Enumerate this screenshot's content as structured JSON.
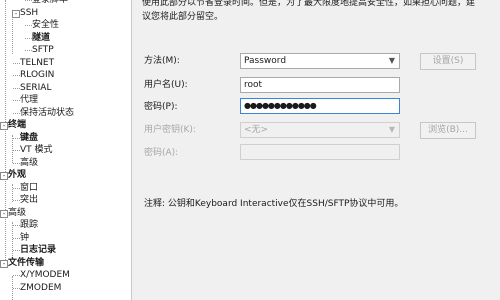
{
  "tree": {
    "items": [
      {
        "label": "登录脚本",
        "level": 2
      },
      {
        "label": "SSH",
        "level": 1,
        "toggle": "-"
      },
      {
        "label": "安全性",
        "level": 2
      },
      {
        "label": "隧道",
        "level": 2,
        "bold": true
      },
      {
        "label": "SFTP",
        "level": 2
      },
      {
        "label": "TELNET",
        "level": 1
      },
      {
        "label": "RLOGIN",
        "level": 1
      },
      {
        "label": "SERIAL",
        "level": 1
      },
      {
        "label": "代理",
        "level": 1
      },
      {
        "label": "保持活动状态",
        "level": 1
      },
      {
        "label": "终端",
        "level": 0,
        "toggle": "-",
        "bold": true
      },
      {
        "label": "键盘",
        "level": 1,
        "bold": true
      },
      {
        "label": "VT 模式",
        "level": 1
      },
      {
        "label": "高级",
        "level": 1
      },
      {
        "label": "外观",
        "level": 0,
        "toggle": "-",
        "bold": true
      },
      {
        "label": "窗口",
        "level": 1
      },
      {
        "label": "突出",
        "level": 1
      },
      {
        "label": "高级",
        "level": 0,
        "toggle": "-"
      },
      {
        "label": "跟踪",
        "level": 1
      },
      {
        "label": "钟",
        "level": 1
      },
      {
        "label": "日志记录",
        "level": 1,
        "bold": true
      },
      {
        "label": "文件传输",
        "level": 0,
        "toggle": "-",
        "bold": true
      },
      {
        "label": "X/YMODEM",
        "level": 1
      },
      {
        "label": "ZMODEM",
        "level": 1
      }
    ]
  },
  "panel": {
    "desc_line1": "使用此部分以节省登录时间。但是，为了最大限度地提高安全性，如果担心问题，建",
    "desc_line2": "议您将此部分留空。",
    "method_label": "方法(M):",
    "method_value": "Password",
    "username_label": "用户名(U):",
    "username_value": "root",
    "password_label": "密码(P):",
    "password_value": "●●●●●●●●●●●●",
    "user_key_label": "用户密钥(K):",
    "user_key_value": "<无>",
    "passphrase_label": "密码(A):",
    "passphrase_value": "",
    "settings_button": "设置(S)",
    "browse_button": "浏览(B)...",
    "note": "注释: 公钥和Keyboard Interactive仅在SSH/SFTP协议中可用。"
  }
}
